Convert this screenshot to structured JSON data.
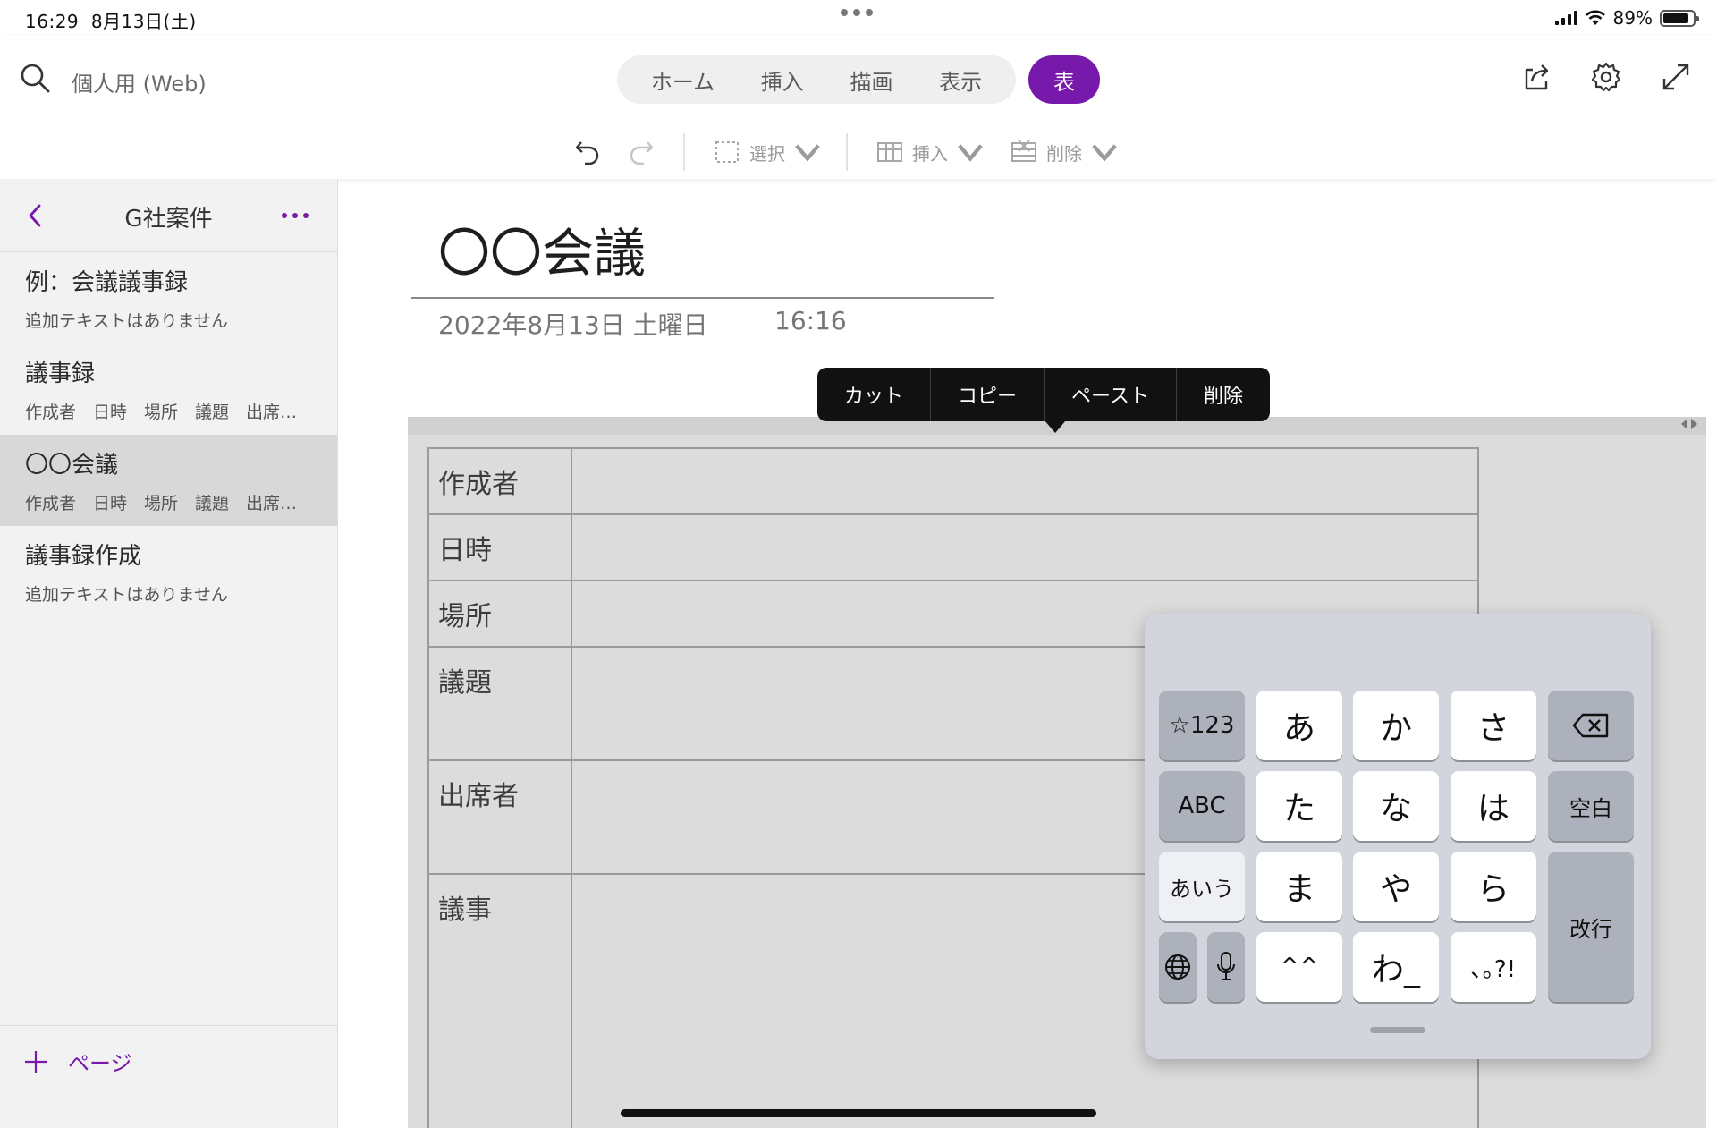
{
  "status": {
    "time": "16:29",
    "date": "8月13日(土)",
    "battery": "89%",
    "battery_level": 0.89
  },
  "toolbar": {
    "notebook": "個人用 (Web)",
    "tabs": [
      "ホーム",
      "挿入",
      "描画",
      "表示"
    ],
    "active_tab": "表",
    "ribbon": {
      "select": "選択",
      "insert": "挿入",
      "delete": "削除"
    },
    "icons": [
      "search-icon",
      "share-icon",
      "gear-icon",
      "expand-icon",
      "undo-icon",
      "redo-icon"
    ]
  },
  "sidebar": {
    "section_title": "G社案件",
    "pages": [
      {
        "title": "例：会議議事録",
        "preview": "追加テキストはありません"
      },
      {
        "title": "議事録",
        "preview": "作成者　日時　場所　議題　出席者..."
      },
      {
        "title": "〇〇会議",
        "preview": "作成者　日時　場所　議題　出席者..."
      },
      {
        "title": "議事録作成",
        "preview": "追加テキストはありません"
      }
    ],
    "add_page": "ページ"
  },
  "page": {
    "title": "〇〇会議",
    "date": "2022年8月13日 土曜日",
    "time": "16:16",
    "table_rows": [
      "作成者",
      "日時",
      "場所",
      "議題",
      "出席者",
      "議事"
    ]
  },
  "context_menu": [
    "カット",
    "コピー",
    "ペースト",
    "削除"
  ],
  "keyboard": {
    "mode_key": "☆123",
    "abc_key": "ABC",
    "kana_key": "あいう",
    "space_key": "空白",
    "return_key": "改行",
    "row1": [
      "あ",
      "か",
      "さ"
    ],
    "row2": [
      "た",
      "な",
      "は"
    ],
    "row3": [
      "ま",
      "や",
      "ら"
    ],
    "row4": [
      "^^",
      "わ_",
      "､｡?!"
    ]
  },
  "colors": {
    "accent": "#7719aa",
    "keyboard_bg": "#d3d5dc"
  }
}
